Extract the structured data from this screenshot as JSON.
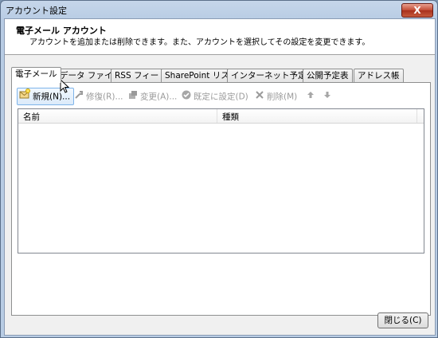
{
  "window": {
    "title": "アカウント設定",
    "close_glyph": "X"
  },
  "header": {
    "title": "電子メール アカウント",
    "description": "アカウントを追加または削除できます。また、アカウントを選択してその設定を変更できます。"
  },
  "tabs": [
    {
      "label": "電子メール",
      "active": true
    },
    {
      "label": "データ ファイル"
    },
    {
      "label": "RSS フィード"
    },
    {
      "label": "SharePoint リスト"
    },
    {
      "label": "インターネット予定表"
    },
    {
      "label": "公開予定表"
    },
    {
      "label": "アドレス帳"
    }
  ],
  "toolbar": {
    "new": "新規(N)...",
    "repair": "修復(R)...",
    "change": "変更(A)...",
    "set_default": "既定に設定(D)",
    "delete": "削除(M)",
    "up_icon": "arrow-up-icon",
    "down_icon": "arrow-down-icon"
  },
  "list": {
    "columns": [
      "名前",
      "種類"
    ],
    "rows": []
  },
  "footer": {
    "close_button": "閉じる(C)"
  }
}
